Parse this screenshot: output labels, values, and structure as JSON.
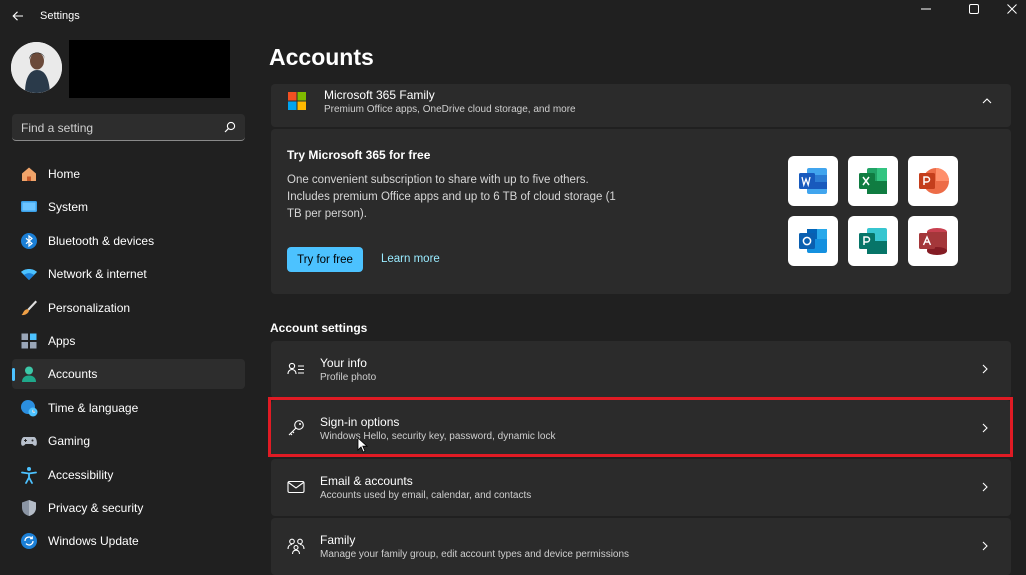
{
  "window": {
    "title": "Settings"
  },
  "search": {
    "placeholder": "Find a setting"
  },
  "sidebar": {
    "items": [
      {
        "label": "Home",
        "icon": "home-icon"
      },
      {
        "label": "System",
        "icon": "system-icon"
      },
      {
        "label": "Bluetooth & devices",
        "icon": "bluetooth-icon"
      },
      {
        "label": "Network & internet",
        "icon": "wifi-icon"
      },
      {
        "label": "Personalization",
        "icon": "brush-icon"
      },
      {
        "label": "Apps",
        "icon": "apps-icon"
      },
      {
        "label": "Accounts",
        "icon": "person-icon",
        "active": true
      },
      {
        "label": "Time & language",
        "icon": "globe-clock-icon"
      },
      {
        "label": "Gaming",
        "icon": "gamepad-icon"
      },
      {
        "label": "Accessibility",
        "icon": "accessibility-icon"
      },
      {
        "label": "Privacy & security",
        "icon": "shield-icon"
      },
      {
        "label": "Windows Update",
        "icon": "update-icon"
      }
    ]
  },
  "main": {
    "title": "Accounts",
    "m365": {
      "title": "Microsoft 365 Family",
      "subtitle": "Premium Office apps, OneDrive cloud storage, and more",
      "promo_title": "Try Microsoft 365 for free",
      "promo_desc": "One convenient subscription to share with up to five others. Includes premium Office apps and up to 6 TB of cloud storage (1 TB per person).",
      "try_label": "Try for free",
      "learn_label": "Learn more",
      "apps": [
        "Word",
        "Excel",
        "PowerPoint",
        "Outlook",
        "Publisher",
        "Access"
      ]
    },
    "section_heading": "Account settings",
    "rows": [
      {
        "title": "Your info",
        "subtitle": "Profile photo",
        "icon": "person-card-icon"
      },
      {
        "title": "Sign-in options",
        "subtitle": "Windows Hello, security key, password, dynamic lock",
        "icon": "key-icon"
      },
      {
        "title": "Email & accounts",
        "subtitle": "Accounts used by email, calendar, and contacts",
        "icon": "mail-icon"
      },
      {
        "title": "Family",
        "subtitle": "Manage your family group, edit account types and device permissions",
        "icon": "family-icon"
      }
    ]
  },
  "colors": {
    "accent": "#4cc2ff",
    "highlight": "#e01b24",
    "background": "#202020",
    "card": "#2b2b2b"
  }
}
